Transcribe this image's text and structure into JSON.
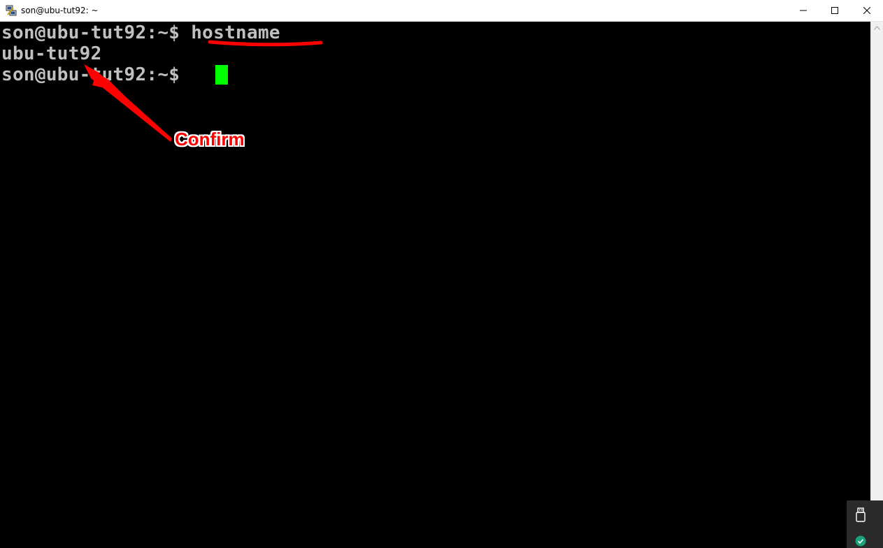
{
  "window": {
    "title": "son@ubu-tut92: ~",
    "controls": {
      "minimize_icon": "minimize-icon",
      "maximize_icon": "maximize-icon",
      "close_icon": "close-icon"
    }
  },
  "terminal": {
    "lines": [
      {
        "prompt": "son@ubu-tut92:~$ ",
        "command": "hostname"
      },
      {
        "output": "ubu-tut92"
      },
      {
        "prompt": "son@ubu-tut92:~$ ",
        "command": ""
      }
    ],
    "text_color": "#c0c0c0",
    "cursor_color": "#00ff00",
    "background_color": "#000000"
  },
  "annotation": {
    "label": "Confirm",
    "color": "#ff0000"
  },
  "tray": {
    "icons": [
      "usb-icon",
      "security-shield-icon"
    ]
  }
}
